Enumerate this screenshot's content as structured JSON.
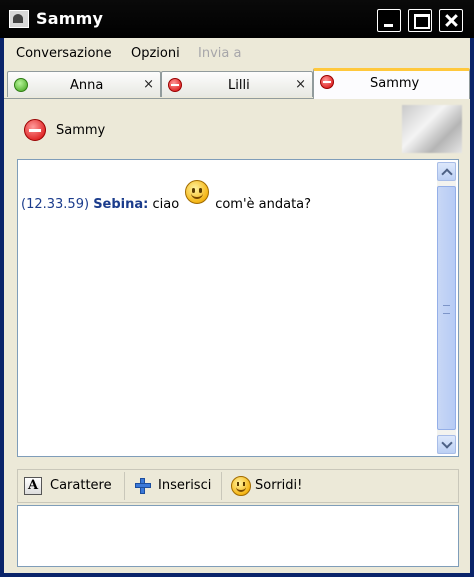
{
  "window": {
    "title": "Sammy"
  },
  "menu": [
    {
      "label": "Conversazione",
      "enabled": true
    },
    {
      "label": "Opzioni",
      "enabled": true
    },
    {
      "label": "Invia a",
      "enabled": false
    }
  ],
  "tabs": [
    {
      "label": "Anna",
      "status": "online",
      "active": false
    },
    {
      "label": "Lilli",
      "status": "busy",
      "active": false
    },
    {
      "label": "Sammy",
      "status": "busy",
      "active": true
    }
  ],
  "contact": {
    "name": "Sammy",
    "status": "busy"
  },
  "messages": [
    {
      "time": "(12.33.59)",
      "sender": "Sebina:",
      "before_emoticon": "ciao",
      "emoticon": "smiley",
      "after_emoticon": "com'è andata?"
    }
  ],
  "toolbar": {
    "font_label": "Carattere",
    "insert_label": "Inserisci",
    "smile_label": "Sorridi!"
  },
  "colors": {
    "title_bar": "#000000",
    "active_tab_accent": "#ffc83c",
    "sender": "#1b3c8c"
  }
}
